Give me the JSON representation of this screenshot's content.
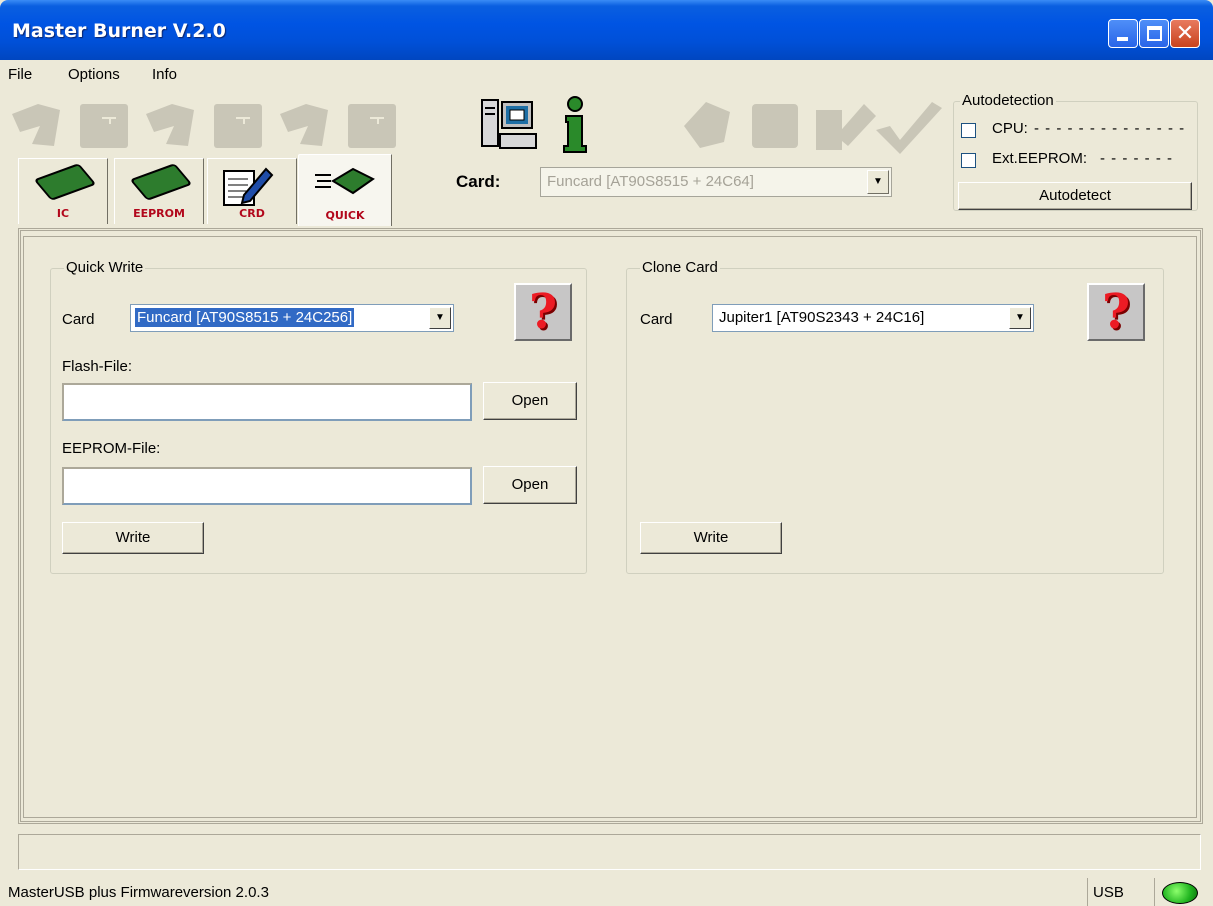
{
  "window": {
    "title": "Master Burner V.2.0"
  },
  "menu": {
    "items": [
      "File",
      "Options",
      "Info"
    ]
  },
  "tabs": [
    {
      "label": "IC"
    },
    {
      "label": "EEPROM"
    },
    {
      "label": "CRD"
    },
    {
      "label": "QUICK"
    }
  ],
  "card": {
    "label": "Card:",
    "value": "Funcard [AT90S8515 + 24C64]"
  },
  "autodetection": {
    "title": "Autodetection",
    "cpu_label": "CPU:",
    "cpu_value": "- - - - - - - - - - - - - -",
    "eeprom_label": "Ext.EEPROM:",
    "eeprom_value": "- - - - - - -",
    "button": "Autodetect"
  },
  "quick_write": {
    "title": "Quick Write",
    "card_label": "Card",
    "card_value": "Funcard [AT90S8515 + 24C256]",
    "flash_label": "Flash-File:",
    "flash_value": "",
    "eeprom_label": "EEPROM-File:",
    "eeprom_value": "",
    "open_label": "Open",
    "write_label": "Write",
    "help_glyph": "?"
  },
  "clone_card": {
    "title": "Clone Card",
    "card_label": "Card",
    "card_value": "Jupiter1 [AT90S2343 + 24C16]",
    "write_label": "Write",
    "help_glyph": "?"
  },
  "statusbar": {
    "text": "MasterUSB plus Firmwareversion 2.0.3",
    "connection": "USB"
  },
  "window_buttons": {
    "close_glyph": "✕"
  }
}
